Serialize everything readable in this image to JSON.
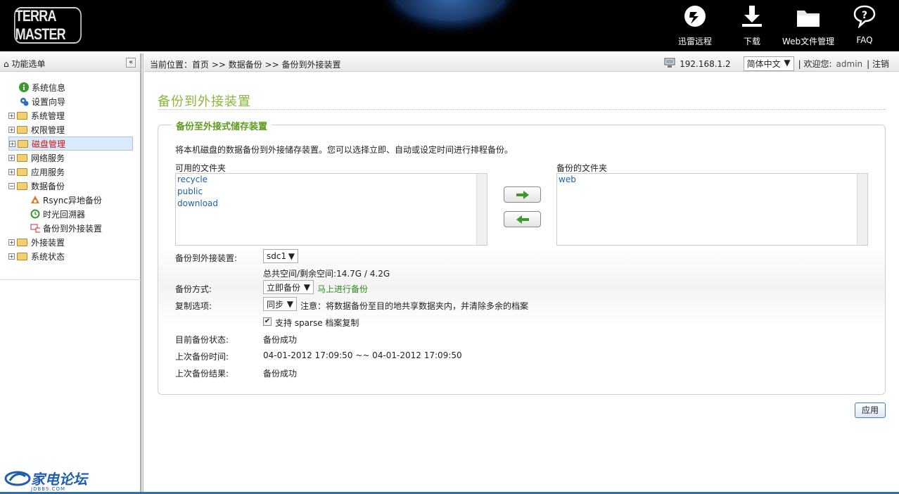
{
  "header": {
    "brand": "TERRA MASTER",
    "nav": [
      {
        "label": "迅雷远程",
        "icon": "thunder-remote-icon"
      },
      {
        "label": "下载",
        "icon": "download-icon"
      },
      {
        "label": "Web文件管理",
        "icon": "folder-icon"
      },
      {
        "label": "FAQ",
        "icon": "faq-icon"
      }
    ]
  },
  "sidebar": {
    "title": "功能选单",
    "collapse": "«",
    "items": [
      {
        "label": "系统信息"
      },
      {
        "label": "设置向导"
      },
      {
        "label": "系统管理"
      },
      {
        "label": "权限管理"
      },
      {
        "label": "磁盘管理"
      },
      {
        "label": "网络服务"
      },
      {
        "label": "应用服务"
      },
      {
        "label": "数据备份"
      },
      {
        "label": "Rsync异地备份"
      },
      {
        "label": "时光回溯器"
      },
      {
        "label": "备份到外接装置"
      },
      {
        "label": "外接装置"
      },
      {
        "label": "系统状态"
      }
    ],
    "footer_logo": "家电论坛",
    "footer_sub": "JDBBS.COM"
  },
  "topbar": {
    "crumb": "当前位置：首页 >> 数据备份 >> 备份到外接装置",
    "ip": "192.168.1.2",
    "language": "简体中文",
    "welcome": "| 欢迎您:",
    "user": "admin",
    "logout": "| 注销"
  },
  "main": {
    "title": "备份到外接装置",
    "legend": "备份至外接式储存装置",
    "description": "将本机磁盘的数据备份到外接储存装置。您可以选择立即、自动或设定时间进行排程备份。",
    "available_label": "可用的文件夹",
    "available": [
      "recycle",
      "public",
      "download"
    ],
    "backup_label": "备份的文件夹",
    "backup": [
      "web"
    ],
    "device_label": "备份到外接装置:",
    "device_value": "sdc1",
    "space": "总共空间/剩余空间:14.7G / 4.2G",
    "mode_label": "备份方式:",
    "mode_value": "立即备份",
    "mode_hint": "马上进行备份",
    "copy_label": "复制选项:",
    "copy_value": "同步",
    "copy_note": "注意：将数据备份至目的地共享数据夹内，并清除多余的档案",
    "sparse_label": "支持 sparse 档案复制",
    "sparse_checked": true,
    "status_label": "目前备份状态:",
    "status_value": "备份成功",
    "last_time_label": "上次备份时间:",
    "last_time_value": "04-01-2012 17:09:50 ~~ 04-01-2012 17:09:50",
    "last_result_label": "上次备份结果:",
    "last_result_value": "备份成功",
    "apply": "应用"
  },
  "colors": {
    "title_green": "#8cb63c",
    "legend_green": "#5f9a1e",
    "link_blue": "#2061a8",
    "selected_red": "#c4181c",
    "header_bg": "#000000"
  }
}
